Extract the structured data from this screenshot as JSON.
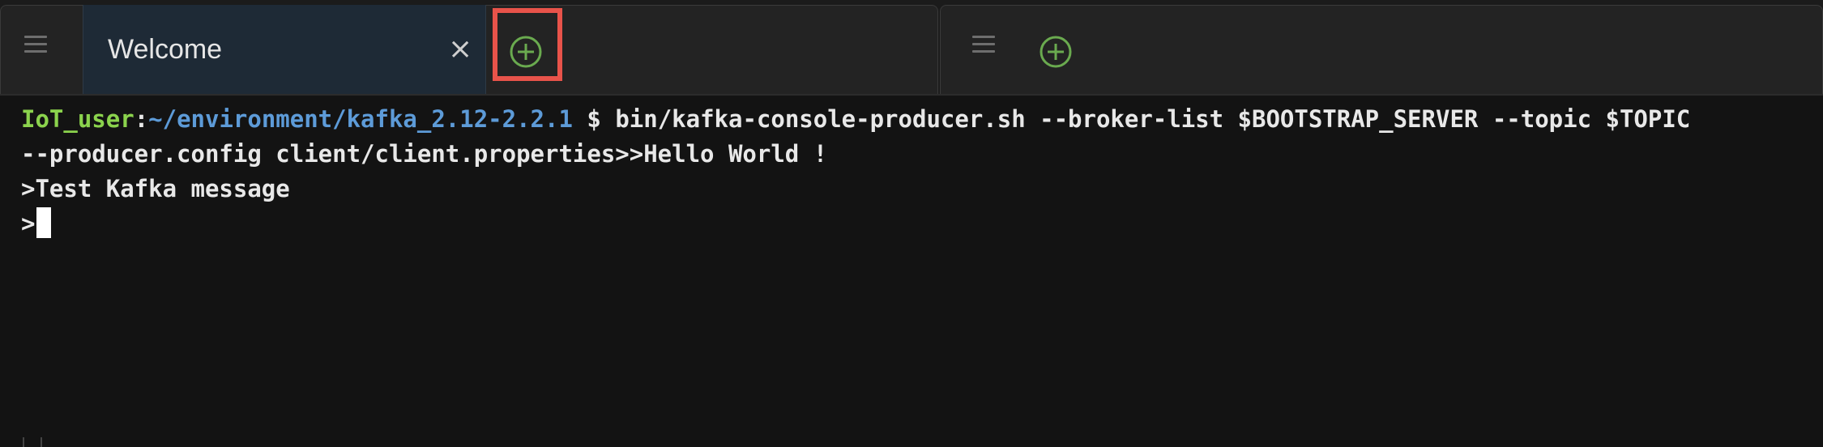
{
  "left_pane": {
    "tab": {
      "title": "Welcome",
      "close_glyph": "×"
    },
    "menu_icon": "hamburger-menu-icon",
    "add_icon": "plus-circle-icon"
  },
  "right_pane": {
    "menu_icon": "hamburger-menu-icon",
    "add_icon": "plus-circle-icon"
  },
  "highlight_color": "#e8534a",
  "accent_green": "#6aaa4f",
  "terminal": {
    "prompt_user": "IoT_user",
    "prompt_sep": ":",
    "prompt_path": "~/environment/kafka_2.12-2.2.1",
    "command": " $ bin/kafka-console-producer.sh --broker-list $BOOTSTRAP_SERVER --topic $TOPIC",
    "line2": "--producer.config client/client.properties>>Hello World !",
    "line3": ">Test Kafka message",
    "line4": ">"
  }
}
